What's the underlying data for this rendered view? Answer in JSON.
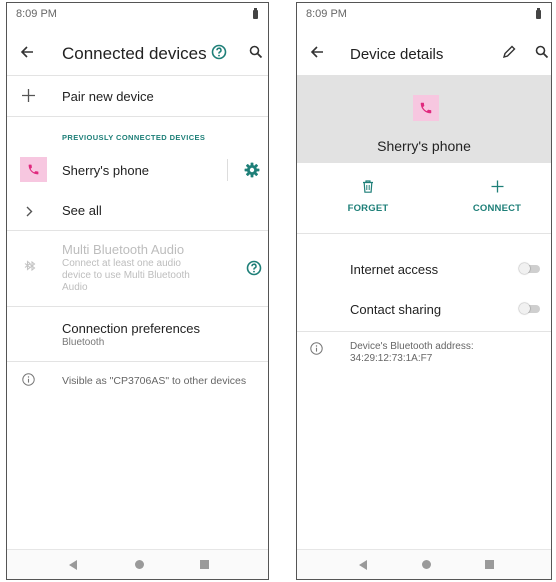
{
  "left": {
    "status": {
      "time": "8:09 PM"
    },
    "app_bar": {
      "title": "Connected devices"
    },
    "pair_new": {
      "label": "Pair new device"
    },
    "section_header": "PREVIOUSLY CONNECTED DEVICES",
    "device": {
      "name": "Sherry's phone"
    },
    "see_all": {
      "label": "See all"
    },
    "multi_audio": {
      "title": "Multi Bluetooth Audio",
      "subtitle_lines": [
        "Connect at least one audio",
        "device to use Multi Bluetooth",
        "Audio"
      ]
    },
    "connection_prefs": {
      "title": "Connection preferences",
      "subtitle": "Bluetooth"
    },
    "visible_as": "Visible as \"CP3706AS\" to other devices"
  },
  "right": {
    "status": {
      "time": "8:09 PM"
    },
    "app_bar": {
      "title": "Device details"
    },
    "device_name": "Sherry's phone",
    "actions": {
      "forget": "FORGET",
      "connect": "CONNECT"
    },
    "toggles": [
      {
        "label": "Internet access",
        "on": false
      },
      {
        "label": "Contact sharing",
        "on": false
      }
    ],
    "address": {
      "label": "Device's Bluetooth address:",
      "value": "34:29:12:73:1A:F7"
    }
  },
  "colors": {
    "accent": "#1e7f78",
    "phone_icon": "#e0297e",
    "phone_badge_bg": "#f7c7e0",
    "header_panel": "#e2e2e2"
  },
  "icons": [
    "back-arrow-icon",
    "help-circle-icon",
    "search-icon",
    "plus-icon",
    "phone-icon",
    "gear-icon",
    "chevron-right-icon",
    "bluetooth-icon",
    "info-icon",
    "edit-pencil-icon",
    "trash-icon",
    "nav-back-icon",
    "nav-home-icon",
    "nav-recents-icon"
  ]
}
